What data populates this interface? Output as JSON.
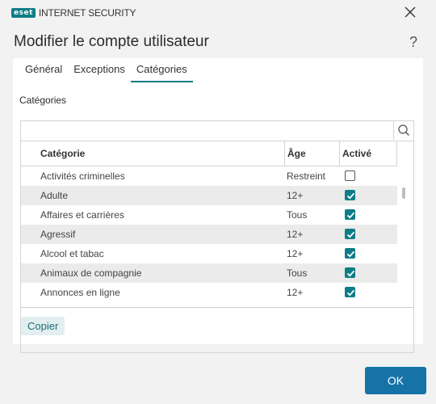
{
  "titlebar": {
    "brand_badge": "eset",
    "brand_name": "INTERNET SECURITY"
  },
  "dialog": {
    "title": "Modifier le compte utilisateur",
    "help": "?"
  },
  "tabs": [
    {
      "label": "Général",
      "active": false
    },
    {
      "label": "Exceptions",
      "active": false
    },
    {
      "label": "Catégories",
      "active": true
    }
  ],
  "section_label": "Catégories",
  "search": {
    "value": "",
    "placeholder": ""
  },
  "table": {
    "headers": {
      "category": "Catégorie",
      "age": "Âge",
      "active": "Activé"
    },
    "rows": [
      {
        "category": "Activités criminelles",
        "age": "Restreint",
        "active": false
      },
      {
        "category": "Adulte",
        "age": "12+",
        "active": true
      },
      {
        "category": "Affaires et carrières",
        "age": "Tous",
        "active": true
      },
      {
        "category": "Agressif",
        "age": "12+",
        "active": true
      },
      {
        "category": "Alcool et tabac",
        "age": "12+",
        "active": true
      },
      {
        "category": "Animaux de compagnie",
        "age": "Tous",
        "active": true
      },
      {
        "category": "Annonces en ligne",
        "age": "12+",
        "active": true
      }
    ]
  },
  "buttons": {
    "copy": "Copier",
    "ok": "OK"
  },
  "colors": {
    "accent": "#0e7d86",
    "primary": "#1673a8"
  }
}
